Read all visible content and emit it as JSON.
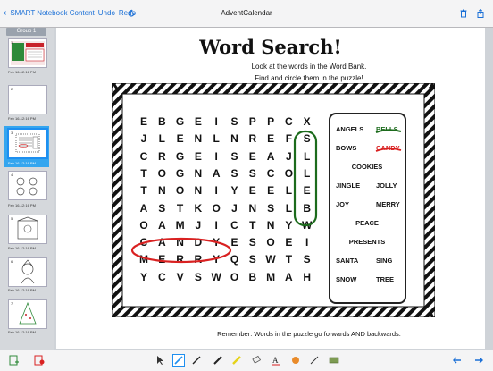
{
  "topbar": {
    "back_label": "SMART Notebook Content",
    "undo_label": "Undo",
    "redo_label": "Redo",
    "title": "AdventCalendar"
  },
  "sidebar": {
    "group_label": "Group 1",
    "pages": [
      {
        "num": "1",
        "date": "Feb 16-12:16 PM"
      },
      {
        "num": "2",
        "date": "Feb 16-12:16 PM"
      },
      {
        "num": "3",
        "date": "Feb 16-12:16 PM"
      },
      {
        "num": "4",
        "date": "Feb 16-12:16 PM"
      },
      {
        "num": "5",
        "date": "Feb 16-12:16 PM"
      },
      {
        "num": "6",
        "date": "Feb 16-12:16 PM"
      },
      {
        "num": "7",
        "date": "Feb 16-12:16 PM"
      }
    ]
  },
  "puzzle": {
    "title": "Word Search!",
    "instruction_1": "Look at the words in the Word Bank.",
    "instruction_2": "Find and circle them in the puzzle!",
    "rows": [
      "EBGEISPPCX",
      "JLENLNREFS",
      "CRGEISEAJL",
      "TOGNASSCOL",
      "TNONIYEELE",
      "ASTKOJNSLB",
      "OAMJICTNYW",
      "CANDYESOEI",
      "MERRYQSWTS",
      "YCVSWOBMAH"
    ],
    "bank": [
      {
        "text": "ANGELS",
        "col": "left"
      },
      {
        "text": "BELLS",
        "col": "right",
        "struck": "green"
      },
      {
        "text": "BOWS",
        "col": "left"
      },
      {
        "text": "CANDY",
        "col": "right",
        "struck": "red"
      },
      {
        "text": "COOKIES",
        "col": "center"
      },
      {
        "text": "JINGLE",
        "col": "left"
      },
      {
        "text": "JOLLY",
        "col": "right"
      },
      {
        "text": "JOY",
        "col": "left"
      },
      {
        "text": "MERRY",
        "col": "right"
      },
      {
        "text": "PEACE",
        "col": "center"
      },
      {
        "text": "PRESENTS",
        "col": "center"
      },
      {
        "text": "SANTA",
        "col": "left"
      },
      {
        "text": "SING",
        "col": "right"
      },
      {
        "text": "SNOW",
        "col": "left"
      },
      {
        "text": "TREE",
        "col": "right"
      }
    ],
    "footer": "Remember: Words in the puzzle go forwards AND backwards."
  },
  "colors": {
    "accent": "#1e8ff0",
    "circle_red": "#d92121",
    "circle_green": "#1c6b1c"
  },
  "toolbar": {
    "tools": [
      "select-arrow-icon",
      "pen-icon",
      "calligraphy-pen-icon",
      "marker-icon",
      "highlighter-icon",
      "eraser-icon",
      "text-icon",
      "fill-icon",
      "line-icon",
      "shape-icon"
    ]
  }
}
